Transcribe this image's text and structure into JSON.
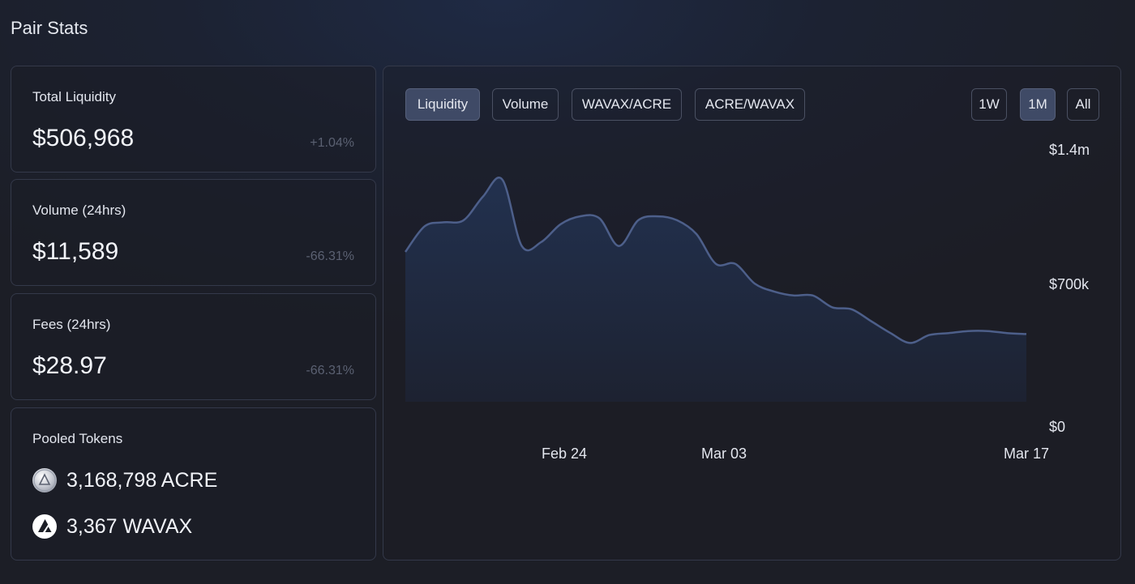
{
  "title": "Pair Stats",
  "stats": {
    "liquidity": {
      "label": "Total Liquidity",
      "value": "$506,968",
      "change": "+1.04%"
    },
    "volume": {
      "label": "Volume (24hrs)",
      "value": "$11,589",
      "change": "-66.31%"
    },
    "fees": {
      "label": "Fees (24hrs)",
      "value": "$28.97",
      "change": "-66.31%"
    }
  },
  "pooled": {
    "label": "Pooled Tokens",
    "tokens": [
      {
        "amount_label": "3,168,798 ACRE",
        "icon": "acre-token-icon"
      },
      {
        "amount_label": "3,367 WAVAX",
        "icon": "avax-token-icon"
      }
    ]
  },
  "chart_controls": {
    "metric_tabs": [
      {
        "label": "Liquidity",
        "active": true
      },
      {
        "label": "Volume",
        "active": false
      },
      {
        "label": "WAVAX/ACRE",
        "active": false
      },
      {
        "label": "ACRE/WAVAX",
        "active": false
      }
    ],
    "ranges": [
      {
        "label": "1W",
        "active": false
      },
      {
        "label": "1M",
        "active": true
      },
      {
        "label": "All",
        "active": false
      }
    ]
  },
  "chart_data": {
    "type": "area",
    "x_tick_labels": [
      "Feb 24",
      "Mar 03",
      "Mar 17"
    ],
    "y_tick_labels": [
      "$1.4m",
      "$700k",
      "$0"
    ],
    "ylim": [
      0,
      1400000
    ],
    "series": [
      {
        "x": [
          "Feb 14",
          "Feb 15",
          "Feb 16",
          "Feb 17",
          "Feb 18",
          "Feb 19",
          "Feb 20",
          "Feb 21",
          "Feb 22",
          "Feb 23",
          "Feb 24",
          "Feb 25",
          "Feb 26",
          "Feb 27",
          "Feb 28",
          "Feb 29",
          "Mar 01",
          "Mar 02",
          "Mar 03",
          "Mar 04",
          "Mar 05",
          "Mar 06",
          "Mar 07",
          "Mar 08",
          "Mar 09",
          "Mar 10",
          "Mar 11",
          "Mar 12",
          "Mar 13",
          "Mar 14",
          "Mar 15",
          "Mar 16",
          "Mar 17"
        ],
        "values": [
          880000,
          1010000,
          1030000,
          1040000,
          1160000,
          1245000,
          910000,
          930000,
          1020000,
          1060000,
          1050000,
          910000,
          1040000,
          1060000,
          1040000,
          970000,
          820000,
          820000,
          720000,
          680000,
          660000,
          660000,
          600000,
          590000,
          530000,
          470000,
          420000,
          460000,
          470000,
          480000,
          480000,
          470000,
          465000
        ]
      }
    ],
    "colors": {
      "line": "#4d5f8a",
      "fill_top": "#22314f",
      "fill_bottom": "#1d2231"
    },
    "grid": false
  }
}
